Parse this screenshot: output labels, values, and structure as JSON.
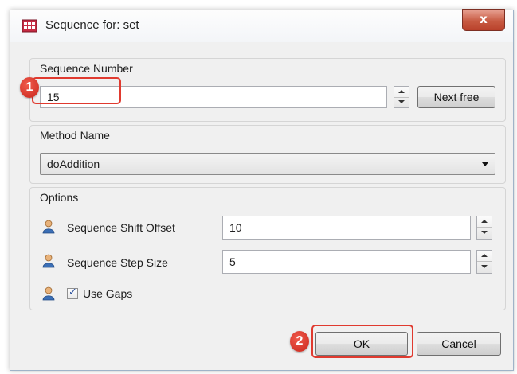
{
  "window": {
    "title": "Sequence for: set",
    "close_label": "x"
  },
  "sequence_number": {
    "group_label": "Sequence Number",
    "value": "15",
    "next_free_label": "Next free"
  },
  "method_name": {
    "group_label": "Method Name",
    "selected": "doAddition"
  },
  "options": {
    "group_label": "Options",
    "shift_offset": {
      "label": "Sequence Shift Offset",
      "value": "10"
    },
    "step_size": {
      "label": "Sequence Step Size",
      "value": "5"
    },
    "use_gaps": {
      "label": "Use Gaps",
      "checked": true
    }
  },
  "buttons": {
    "ok_label": "OK",
    "cancel_label": "Cancel"
  },
  "annotations": {
    "marker_1": "1",
    "marker_2": "2",
    "highlight_color": "#e03a2f"
  },
  "colors": {
    "title_bar": "#f3f5f8",
    "dialog_bg": "#f0f0f0",
    "close_button": "#c85b43",
    "person_icon": "#3b6fb6"
  }
}
